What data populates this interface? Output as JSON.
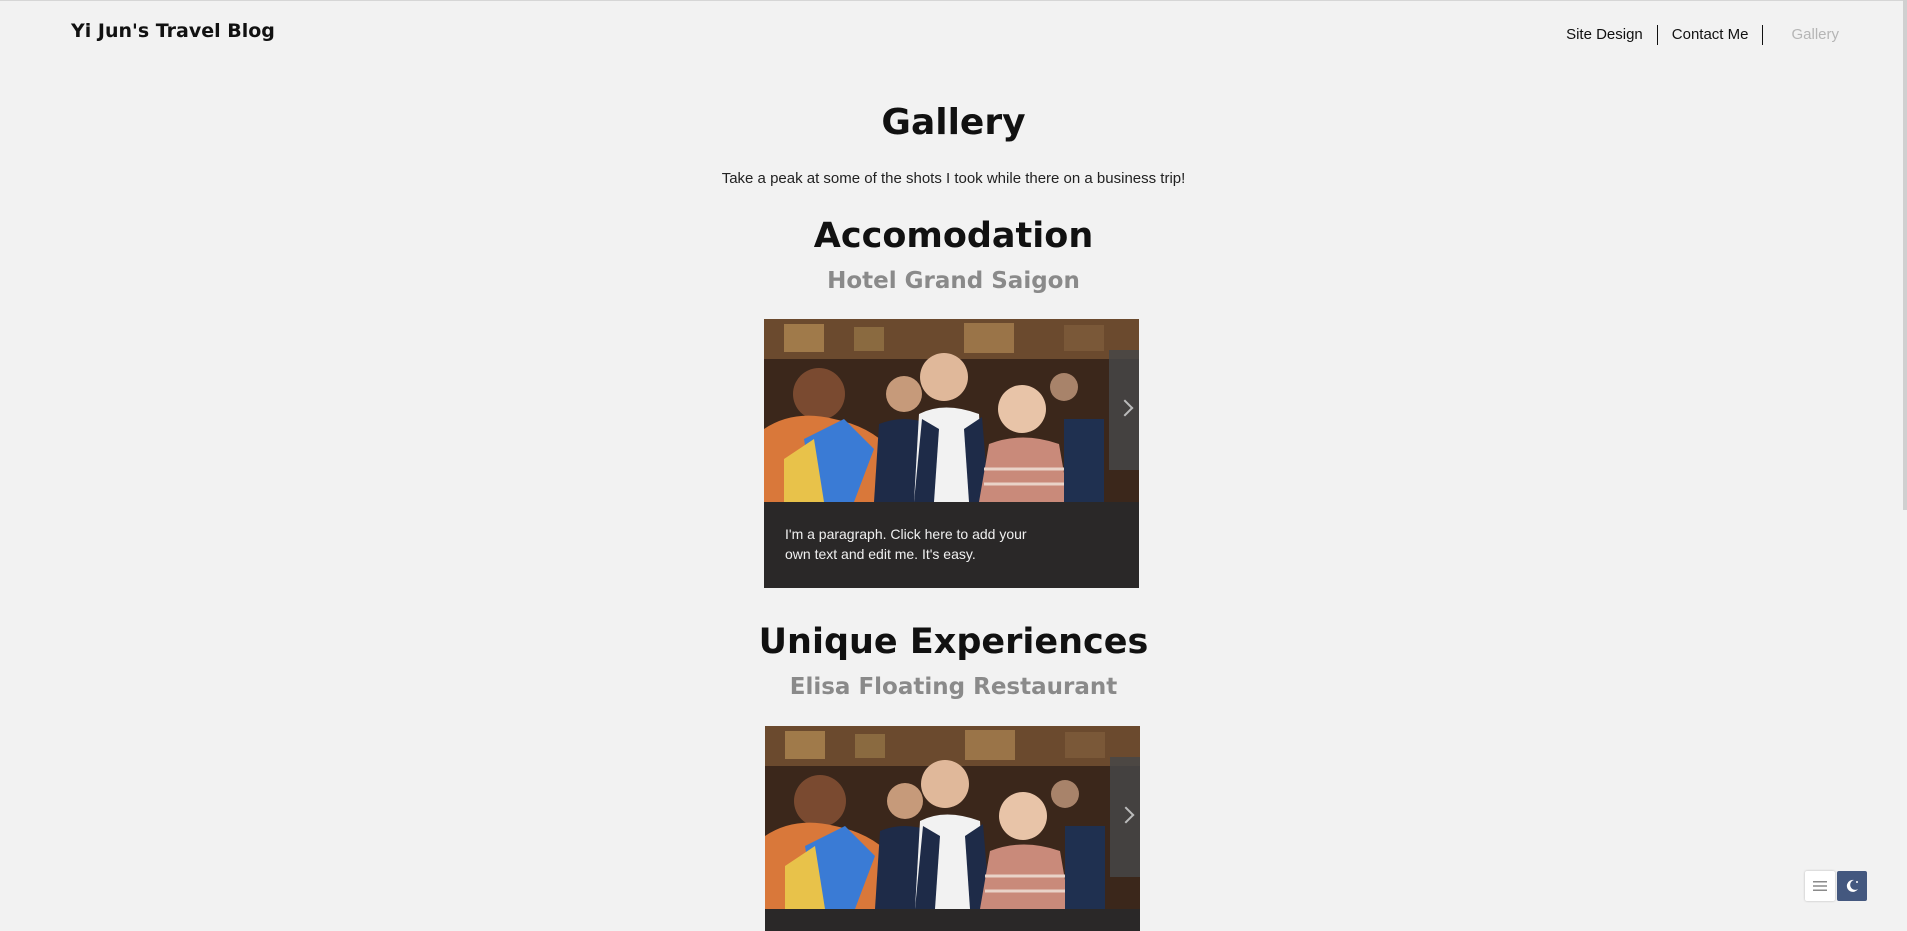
{
  "header": {
    "site_title": "Yi Jun's Travel Blog",
    "nav": [
      {
        "label": "Site Design",
        "active": false
      },
      {
        "label": "Contact Me",
        "active": false
      },
      {
        "label": "Gallery",
        "active": true
      }
    ]
  },
  "page": {
    "title": "Gallery",
    "subtitle": "Take a peak at some of the shots I took while there on a business trip!"
  },
  "sections": [
    {
      "title": "Accomodation",
      "subtitle": "Hotel Grand Saigon",
      "caption": "I'm a paragraph. Click here to add your own text and edit me. It's easy."
    },
    {
      "title": "Unique Experiences",
      "subtitle": "Elisa Floating Restaurant"
    }
  ],
  "widgets": {
    "list_icon": "list-icon",
    "moon_icon": "moon-icon",
    "moon_color": "#44587f"
  },
  "colors": {
    "background": "#f2f2f2",
    "card": "#2a2828",
    "inactive_nav": "#b5b5b5",
    "subtitle_gray": "#8a8a8a"
  }
}
